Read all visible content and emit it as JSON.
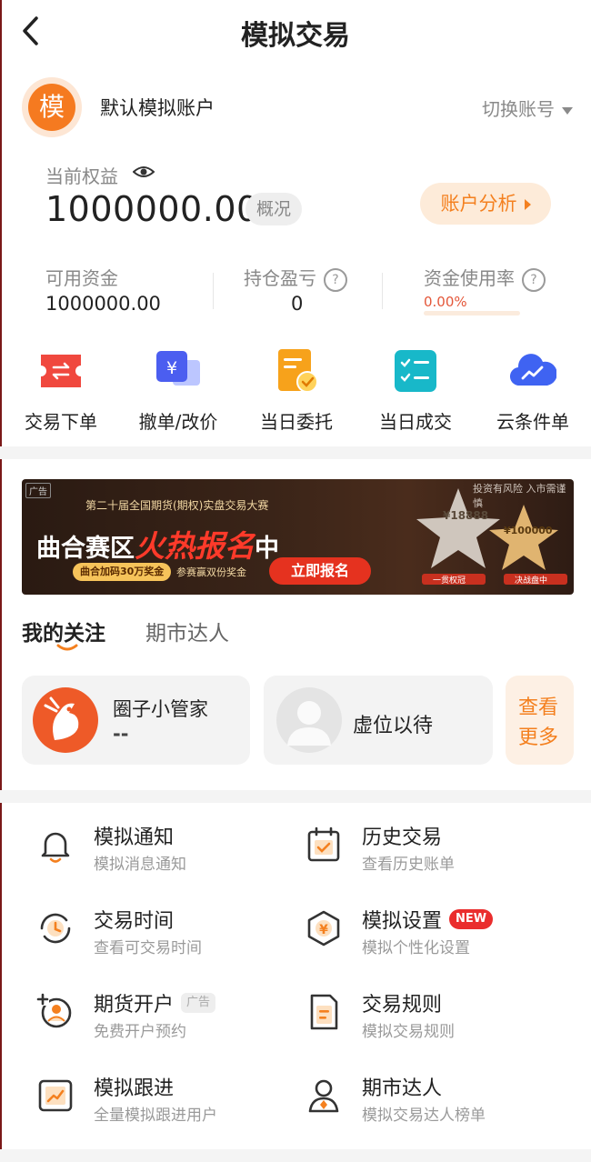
{
  "header": {
    "title": "模拟交易"
  },
  "account": {
    "avatar_char": "模",
    "name": "默认模拟账户",
    "switch_label": "切换账号",
    "equity_label": "当前权益",
    "equity_value": "1000000.00",
    "overview_label": "概况",
    "analysis_label": "账户分析"
  },
  "stats": {
    "available_label": "可用资金",
    "available_value": "1000000.00",
    "pnl_label": "持仓盈亏",
    "pnl_value": "0",
    "usage_label": "资金使用率",
    "usage_value": "0.00%",
    "usage_fraction": 0
  },
  "quick_actions": [
    {
      "label": "交易下单",
      "icon": "trade-order-icon"
    },
    {
      "label": "撤单/改价",
      "icon": "cancel-modify-icon"
    },
    {
      "label": "当日委托",
      "icon": "daily-orders-icon"
    },
    {
      "label": "当日成交",
      "icon": "daily-deals-icon"
    },
    {
      "label": "云条件单",
      "icon": "cloud-condition-icon"
    }
  ],
  "banner": {
    "ad_tag": "广告",
    "risk_note": "投资有风险 入市需谨慎",
    "subtitle": "第二十届全国期货(期权)实盘交易大赛",
    "title_part1": "曲合赛区",
    "title_part2": "火热报名",
    "title_part3": "中",
    "bonus_text": "曲合加码30万奖金",
    "double_text": "参赛赢双份奖金",
    "cta": "立即报名",
    "prize1": "¥18888",
    "prize2": "¥100000",
    "ribbon1": "一贯权冠",
    "ribbon2": "决战盘中"
  },
  "tabs": {
    "focus": "我的关注",
    "experts": "期市达人"
  },
  "follow_cards": [
    {
      "name": "圈子小管家",
      "sub": "--"
    },
    {
      "name": "虚位以待"
    }
  ],
  "more_card": {
    "line1": "查看",
    "line2": "更多"
  },
  "menu": [
    {
      "title": "模拟通知",
      "sub": "模拟消息通知",
      "icon": "bell-icon"
    },
    {
      "title": "历史交易",
      "sub": "查看历史账单",
      "icon": "history-icon"
    },
    {
      "title": "交易时间",
      "sub": "查看可交易时间",
      "icon": "clock-icon"
    },
    {
      "title": "模拟设置",
      "sub": "模拟个性化设置",
      "icon": "settings-icon",
      "badge": "NEW"
    },
    {
      "title": "期货开户",
      "sub": "免费开户预约",
      "icon": "open-account-icon",
      "badge": "广告"
    },
    {
      "title": "交易规则",
      "sub": "模拟交易规则",
      "icon": "rules-icon"
    },
    {
      "title": "模拟跟进",
      "sub": "全量模拟跟进用户",
      "icon": "follow-chart-icon"
    },
    {
      "title": "期市达人",
      "sub": "模拟交易达人榜单",
      "icon": "expert-icon"
    }
  ],
  "colors": {
    "accent": "#f4801f",
    "red": "#e4573a"
  }
}
